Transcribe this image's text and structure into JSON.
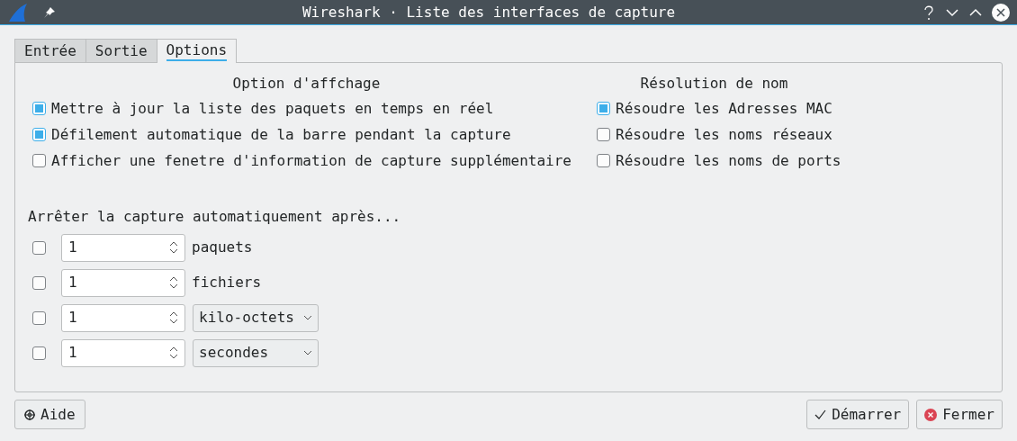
{
  "window": {
    "title": "Wireshark · Liste des interfaces de capture"
  },
  "tabs": [
    {
      "label": "Entrée",
      "selected": false
    },
    {
      "label": "Sortie",
      "selected": false
    },
    {
      "label": "Options",
      "selected": true
    }
  ],
  "display_options": {
    "title": "Option d'affchage",
    "items": [
      {
        "label": "Mettre à jour la liste des paquets en temps en réel",
        "checked": true
      },
      {
        "label": "Défilement automatique de la barre pendant la capture",
        "checked": true
      },
      {
        "label": "Afficher une fenetre d'information de capture supplémentaire",
        "checked": false
      }
    ]
  },
  "name_resolution": {
    "title": "Résolution de nom",
    "items": [
      {
        "label": "Résoudre les Adresses MAC",
        "checked": true
      },
      {
        "label": "Résoudre les noms réseaux",
        "checked": false
      },
      {
        "label": "Résoudre les noms de ports",
        "checked": false
      }
    ]
  },
  "auto_stop": {
    "title": "Arrêter la capture automatiquement après...",
    "rows": [
      {
        "checked": false,
        "value": "1",
        "kind": "label",
        "unit": "paquets"
      },
      {
        "checked": false,
        "value": "1",
        "kind": "label",
        "unit": "fichiers"
      },
      {
        "checked": false,
        "value": "1",
        "kind": "select",
        "unit": "kilo-octets"
      },
      {
        "checked": false,
        "value": "1",
        "kind": "select",
        "unit": "secondes"
      }
    ]
  },
  "buttons": {
    "help": "Aide",
    "start": "Démarrer",
    "close": "Fermer"
  }
}
